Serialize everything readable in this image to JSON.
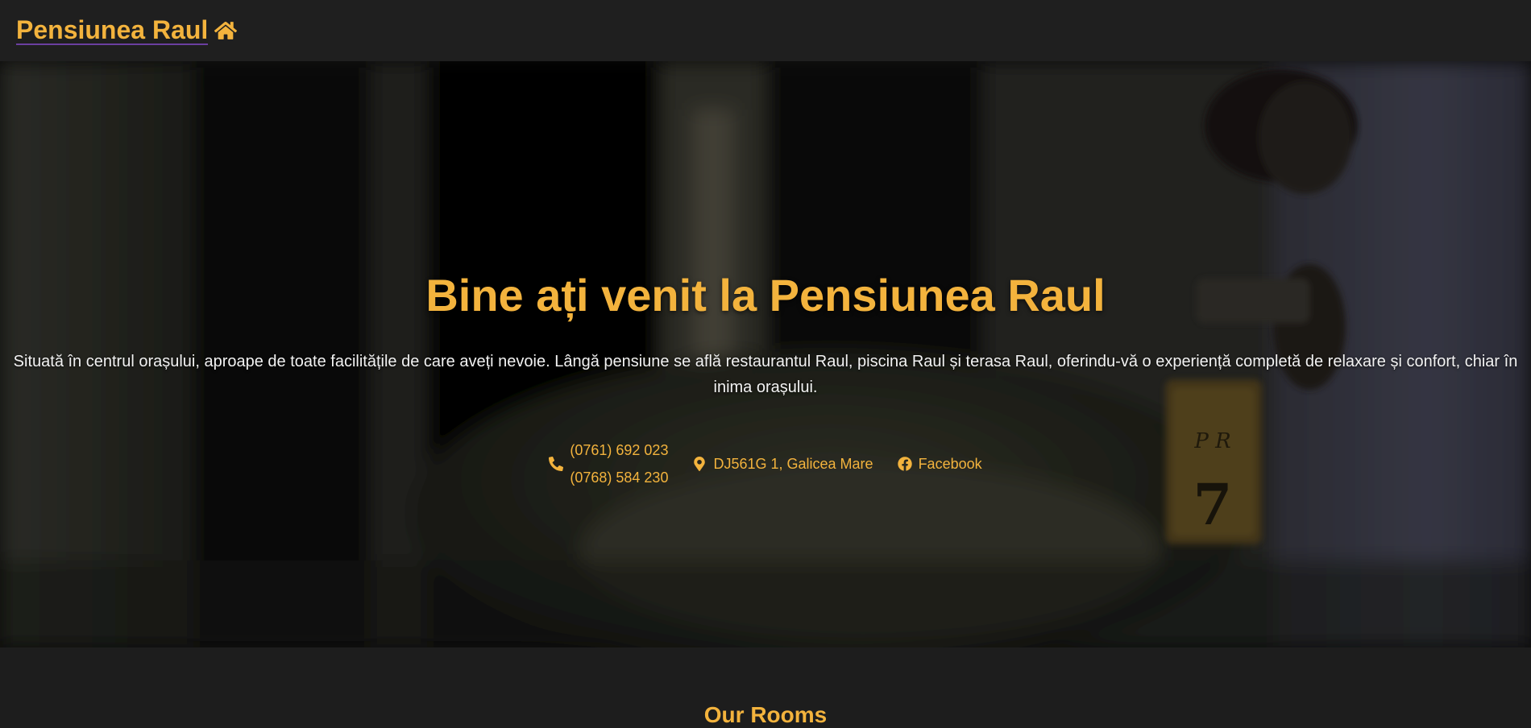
{
  "navbar": {
    "brand": "Pensiunea Raul",
    "brand_icon": "home-icon"
  },
  "hero": {
    "title": "Bine ați venit la Pensiunea Raul",
    "description": "Situată în centrul orașului, aproape de toate facilitățile de care aveți nevoie. Lângă pensiune se află restaurantul Raul, piscina Raul și terasa Raul, oferindu-vă o experiență completă de relaxare și confort, chiar în inima orașului.",
    "phones": [
      "(0761) 692 023",
      "(0768) 584 230"
    ],
    "address": "DJ561G 1, Galicea Mare",
    "facebook": "Facebook",
    "icons": {
      "phone": "phone-icon",
      "address": "map-marker-icon",
      "facebook": "facebook-icon"
    }
  },
  "rooms": {
    "title": "Our Rooms"
  },
  "colors": {
    "accent": "#f3b33d",
    "navbar_bg": "#1f1f1f",
    "page_bg": "#1d1d1d"
  }
}
